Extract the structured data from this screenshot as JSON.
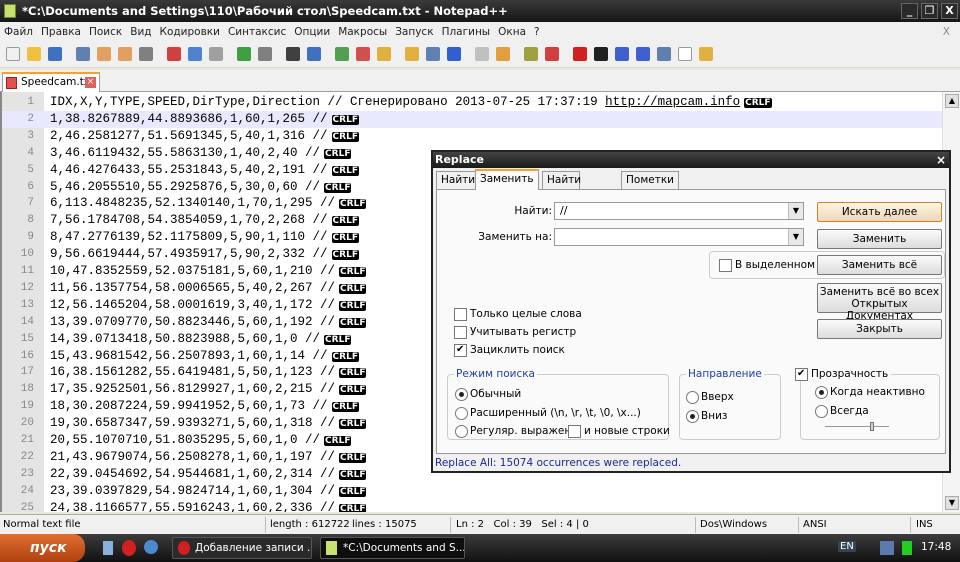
{
  "window": {
    "title": "*C:\\Documents and Settings\\110\\Рабочий стол\\Speedcam.txt - Notepad++"
  },
  "menu": [
    "Файл",
    "Правка",
    "Поиск",
    "Вид",
    "Кодировки",
    "Синтаксис",
    "Опции",
    "Макросы",
    "Запуск",
    "Плагины",
    "Окна",
    "?"
  ],
  "menu_close": "X",
  "tab": {
    "label": "Speedcam.txt"
  },
  "editor": {
    "current_line": 2,
    "lines": [
      {
        "n": "1",
        "text": "IDX,X,Y,TYPE,SPEED,DirType,Direction // Сгенерировано 2013-07-25 17:37:19 ",
        "url": "http://mapcam.info"
      },
      {
        "n": "2",
        "text": "1,38.8267889,44.8893686,1,60,1,265 //"
      },
      {
        "n": "3",
        "text": "2,46.2581277,51.5691345,5,40,1,316 //"
      },
      {
        "n": "4",
        "text": "3,46.6119432,55.5863130,1,40,2,40 //"
      },
      {
        "n": "5",
        "text": "4,46.4276433,55.2531843,5,40,2,191 //"
      },
      {
        "n": "6",
        "text": "5,46.2055510,55.2925876,5,30,0,60 //"
      },
      {
        "n": "7",
        "text": "6,113.4848235,52.1340140,1,70,1,295 //"
      },
      {
        "n": "8",
        "text": "7,56.1784708,54.3854059,1,70,2,268 //"
      },
      {
        "n": "9",
        "text": "8,47.2776139,52.1175809,5,90,1,110 //"
      },
      {
        "n": "10",
        "text": "9,56.6619444,57.4935917,5,90,2,332 //"
      },
      {
        "n": "11",
        "text": "10,47.8352559,52.0375181,5,60,1,210 //"
      },
      {
        "n": "12",
        "text": "11,56.1357754,58.0006565,5,40,2,267 //"
      },
      {
        "n": "13",
        "text": "12,56.1465204,58.0001619,3,40,1,172 //"
      },
      {
        "n": "14",
        "text": "13,39.0709770,50.8823446,5,60,1,192 //"
      },
      {
        "n": "15",
        "text": "14,39.0713418,50.8823988,5,60,1,0 //"
      },
      {
        "n": "16",
        "text": "15,43.9681542,56.2507893,1,60,1,14 //"
      },
      {
        "n": "17",
        "text": "16,38.1561282,55.6419481,5,50,1,123 //"
      },
      {
        "n": "18",
        "text": "17,35.9252501,56.8129927,1,60,2,215 //"
      },
      {
        "n": "19",
        "text": "18,30.2087224,59.9941952,5,60,1,73 //"
      },
      {
        "n": "20",
        "text": "19,30.6587347,59.9393271,5,60,1,318 //"
      },
      {
        "n": "21",
        "text": "20,55.1070710,51.8035295,5,60,1,0 //"
      },
      {
        "n": "22",
        "text": "21,43.9679074,56.2508278,1,60,1,197 //"
      },
      {
        "n": "23",
        "text": "22,39.0454692,54.9544681,1,60,2,314 //"
      },
      {
        "n": "24",
        "text": "23,39.0397829,54.9824714,1,60,1,304 //"
      },
      {
        "n": "25",
        "text": "24,38.1166577,55.5916243,1,60,2,336 //"
      }
    ],
    "eol": "CRLF"
  },
  "status": {
    "type": "Normal text file",
    "length": "length : 612722",
    "lines": "lines : 15075",
    "pos": "Ln : 2   Col : 39   Sel : 4 | 0",
    "eol": "Dos\\Windows",
    "encoding": "ANSI",
    "mode": "INS"
  },
  "taskbar": {
    "start": "пуск",
    "tasks": [
      "Добавление записи ...",
      "*C:\\Documents and S..."
    ],
    "lang": "EN",
    "clock": "17:48"
  },
  "dialog": {
    "title": "Replace",
    "close": "×",
    "tabs": [
      "Найти",
      "Заменить",
      "Найти в файлах",
      "Пометки"
    ],
    "active_tab": 1,
    "find_label": "Найти:",
    "find_value": "//",
    "replace_label": "Заменить на:",
    "replace_value": "",
    "in_selection": "В выделенном",
    "buttons": {
      "find_next": "Искать далее",
      "replace": "Заменить",
      "replace_all": "Заменить всё",
      "replace_all_docs_1": "Заменить всё во всех",
      "replace_all_docs_2": "Открытых Документах",
      "close": "Закрыть"
    },
    "options": [
      {
        "label": "Только целые слова",
        "checked": false
      },
      {
        "label": "Учитывать регистр",
        "checked": false
      },
      {
        "label": "Зациклить поиск",
        "checked": true
      }
    ],
    "search_mode": {
      "title": "Режим поиска",
      "items": [
        "Обычный",
        "Расширенный (\\n, \\r, \\t, \\0, \\x...)",
        "Регуляр. выражен."
      ],
      "selected": 0,
      "newline_label": "и новые строки"
    },
    "direction": {
      "title": "Направление",
      "items": [
        "Вверх",
        "Вниз"
      ],
      "selected": 1
    },
    "transparency": {
      "title": "Прозрачность",
      "checked": true,
      "items": [
        "Когда неактивно",
        "Всегда"
      ],
      "selected": 0,
      "level": 0.75
    },
    "status": "Replace All: 15074 occurrences were replaced."
  }
}
